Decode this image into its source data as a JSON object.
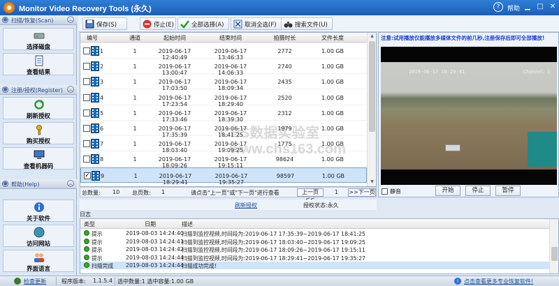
{
  "window": {
    "title": "Monitor Video Recovery Tools (永久)",
    "help_label": "帮助",
    "controls": [
      "minimize-icon",
      "maximize-icon",
      "close-icon"
    ]
  },
  "sidebar": {
    "sections": [
      {
        "label": "扫描/恢复(Scan)",
        "items": [
          {
            "label": "选择磁盘",
            "icon": "disk-drive-icon"
          },
          {
            "label": "查看结果",
            "icon": "document-list-icon"
          }
        ]
      },
      {
        "label": "注册/授权(Register)",
        "items": [
          {
            "label": "刷新授权",
            "icon": "refresh-icon"
          },
          {
            "label": "购买授权",
            "icon": "key-icon"
          },
          {
            "label": "查看机器码",
            "icon": "computer-icon"
          }
        ]
      },
      {
        "label": "帮助(Help)",
        "items": [
          {
            "label": "关于软件",
            "icon": "info-icon"
          },
          {
            "label": "访问网站",
            "icon": "globe-icon"
          },
          {
            "label": "界面语言",
            "icon": "users-icon"
          }
        ]
      }
    ]
  },
  "toolbar": {
    "buttons": [
      {
        "label": "保存(S)",
        "icon": "save-icon"
      },
      {
        "label": "停止(E)",
        "icon": "stop-icon"
      },
      {
        "label": "全部选择(A)",
        "icon": "checkmark-icon"
      },
      {
        "label": "取消全选(F)",
        "icon": "uncheck-icon"
      },
      {
        "label": "搜索文件(U)",
        "icon": "binoculars-icon"
      }
    ]
  },
  "table": {
    "columns": [
      "编号",
      "通道",
      "起始时间",
      "结束时间",
      "拍摄时长",
      "文件长度"
    ],
    "rows": [
      {
        "num": "1",
        "channel": "1",
        "start": "2019-06-17 12:40:49",
        "end": "2019-06-17 13:46:33",
        "duration": "2772",
        "size": "1.00 GB",
        "checked": false
      },
      {
        "num": "2",
        "channel": "1",
        "start": "2019-06-17 13:00:47",
        "end": "2019-06-17 14:06:33",
        "duration": "2740",
        "size": "1.00 GB",
        "checked": false
      },
      {
        "num": "3",
        "channel": "1",
        "start": "2019-06-17 17:03:50",
        "end": "2019-06-17 18:09:34",
        "duration": "2435",
        "size": "1.00 GB",
        "checked": false
      },
      {
        "num": "4",
        "channel": "1",
        "start": "2019-06-17 17:23:54",
        "end": "2019-06-17 18:29:40",
        "duration": "2520",
        "size": "1.00 GB",
        "checked": false
      },
      {
        "num": "5",
        "channel": "1",
        "start": "2019-06-17 17:33:46",
        "end": "2019-06-17 18:39:30",
        "duration": "2312",
        "size": "1.00 GB",
        "checked": false
      },
      {
        "num": "6",
        "channel": "1",
        "start": "2019-06-17 17:35:39",
        "end": "2019-06-17 18:41:25",
        "duration": "1979",
        "size": "1.00 GB",
        "checked": false
      },
      {
        "num": "7",
        "channel": "1",
        "start": "2019-06-17 18:03:40",
        "end": "2019-06-17 19:09:25",
        "duration": "1775",
        "size": "1.00 GB",
        "checked": false
      },
      {
        "num": "8",
        "channel": "1",
        "start": "2019-06-17 18:09:26",
        "end": "2019-06-17 19:15:11",
        "duration": "98624",
        "size": "1.00 GB",
        "checked": false
      },
      {
        "num": "9",
        "channel": "1",
        "start": "2019-06-17 18:29:41",
        "end": "2019-06-17 19:35:27",
        "duration": "98597",
        "size": "1.00 GB",
        "checked": true
      }
    ]
  },
  "pager": {
    "total_label": "总数量:",
    "total": "10",
    "pages_label": "总页数:",
    "pages": "1",
    "hint": "请点击\"上一页\"或\"下一页\"进行查看",
    "prev": "上一页<<",
    "page": "1",
    "next": ">>下一页"
  },
  "license": {
    "refresh_link": "刷新授权",
    "status": "授权状态:永久"
  },
  "video": {
    "note": "注意:试用播放仅能播放多媒体文件的前几秒,注册保存后即可全部播放!",
    "osd_time": "2019-06-17 18:29:41",
    "osd_channel": "Channel 1",
    "mute_label": "静音",
    "buttons": [
      "开始",
      "停止",
      "暂停"
    ]
  },
  "log": {
    "title": "日志",
    "columns": [
      "类型",
      "日期",
      "描述"
    ],
    "rows": [
      {
        "type": "提示",
        "date": "2019-08-03 14:24:40",
        "desc": "扫描到监控视频,时间段为:2019-06-17 17:35:39~2019-06-17 18:41:25",
        "selected": false
      },
      {
        "type": "提示",
        "date": "2019-08-03 14:24:41",
        "desc": "扫描到监控视频,时间段为:2019-06-17 18:03:40~2019-06-17 19:09:25",
        "selected": false
      },
      {
        "type": "提示",
        "date": "2019-08-03 14:24:42",
        "desc": "扫描到监控视频,时间段为:2019-06-17 18:09:26~2019-06-17 19:15:11",
        "selected": false
      },
      {
        "type": "提示",
        "date": "2019-08-03 14:24:44",
        "desc": "扫描到监控视频,时间段为:2019-06-17 18:29:41~2019-06-17 19:35:27",
        "selected": false
      },
      {
        "type": "扫描完成",
        "date": "2019-08-03 14:24:44",
        "desc": "扫描成功完成!",
        "selected": true
      }
    ]
  },
  "status": {
    "check_update": "检查更新",
    "version_label": "程序版本:",
    "version": "1.1.5.4",
    "selection": "选中数量:1 选中容量:1.00 GB",
    "more_link": "点击查看更多专业恢复软件!"
  },
  "watermark": {
    "line1": "CHS数据实验室",
    "line2": "www.chs163.com"
  }
}
